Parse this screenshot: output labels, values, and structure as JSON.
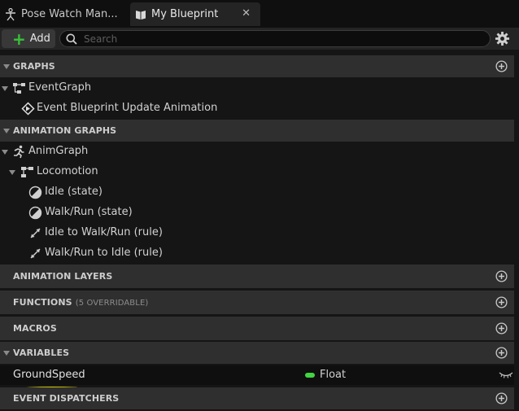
{
  "tabs": [
    {
      "label": "Pose Watch Man...",
      "icon": "pose-figure-icon"
    },
    {
      "label": "My Blueprint",
      "icon": "blueprint-book-icon",
      "close": "✕"
    }
  ],
  "toolbar": {
    "add_label": "Add",
    "search_placeholder": "Search",
    "settings_icon": "gear-icon"
  },
  "sections": {
    "graphs": "GRAPHS",
    "animation_graphs": "ANIMATION GRAPHS",
    "animation_layers": "ANIMATION LAYERS",
    "functions": "FUNCTIONS",
    "functions_sub": "(5 OVERRIDABLE)",
    "macros": "MACROS",
    "variables": "VARIABLES",
    "event_dispatchers": "EVENT DISPATCHERS"
  },
  "graphs": {
    "event_graph": "EventGraph",
    "event_update": "Event Blueprint Update Animation"
  },
  "anim_graphs": {
    "anim_graph": "AnimGraph",
    "locomotion": "Locomotion",
    "items": [
      {
        "label": "Idle (state)",
        "icon": "state-icon"
      },
      {
        "label": "Walk/Run (state)",
        "icon": "state-icon"
      },
      {
        "label": "Idle to Walk/Run (rule)",
        "icon": "transition-rule-icon"
      },
      {
        "label": "Walk/Run to Idle (rule)",
        "icon": "transition-rule-icon"
      }
    ]
  },
  "variables": [
    {
      "name": "GroundSpeed",
      "type": "Float",
      "type_color": "#42d442"
    }
  ],
  "colors": {
    "accent_green": "#38c238",
    "highlight_underline": "#f2e600",
    "float_pin": "#42d442"
  }
}
